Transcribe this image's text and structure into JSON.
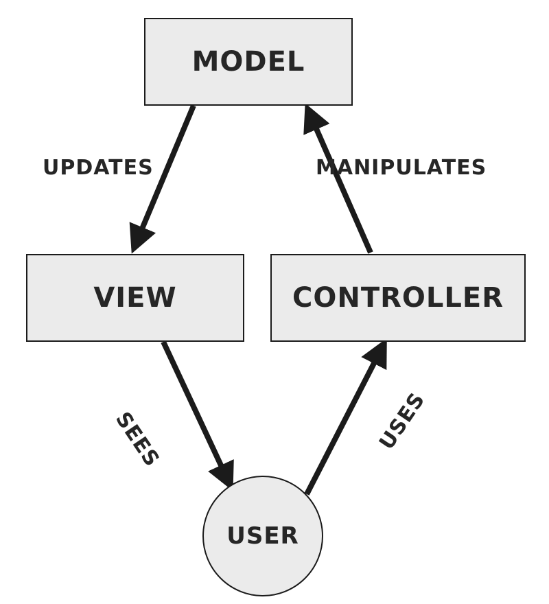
{
  "nodes": {
    "model": {
      "label": "MODEL"
    },
    "view": {
      "label": "VIEW"
    },
    "controller": {
      "label": "CONTROLLER"
    },
    "user": {
      "label": "USER"
    }
  },
  "edges": {
    "model_to_view": {
      "label": "UPDATES",
      "from": "model",
      "to": "view"
    },
    "controller_to_model": {
      "label": "MANIPULATES",
      "from": "controller",
      "to": "model"
    },
    "view_to_user": {
      "label": "SEES",
      "from": "view",
      "to": "user"
    },
    "user_to_controller": {
      "label": "USES",
      "from": "user",
      "to": "controller"
    }
  },
  "colors": {
    "box_fill": "#ebebeb",
    "box_stroke": "#1b1b1b",
    "text": "#262626",
    "arrow": "#1b1b1b"
  }
}
